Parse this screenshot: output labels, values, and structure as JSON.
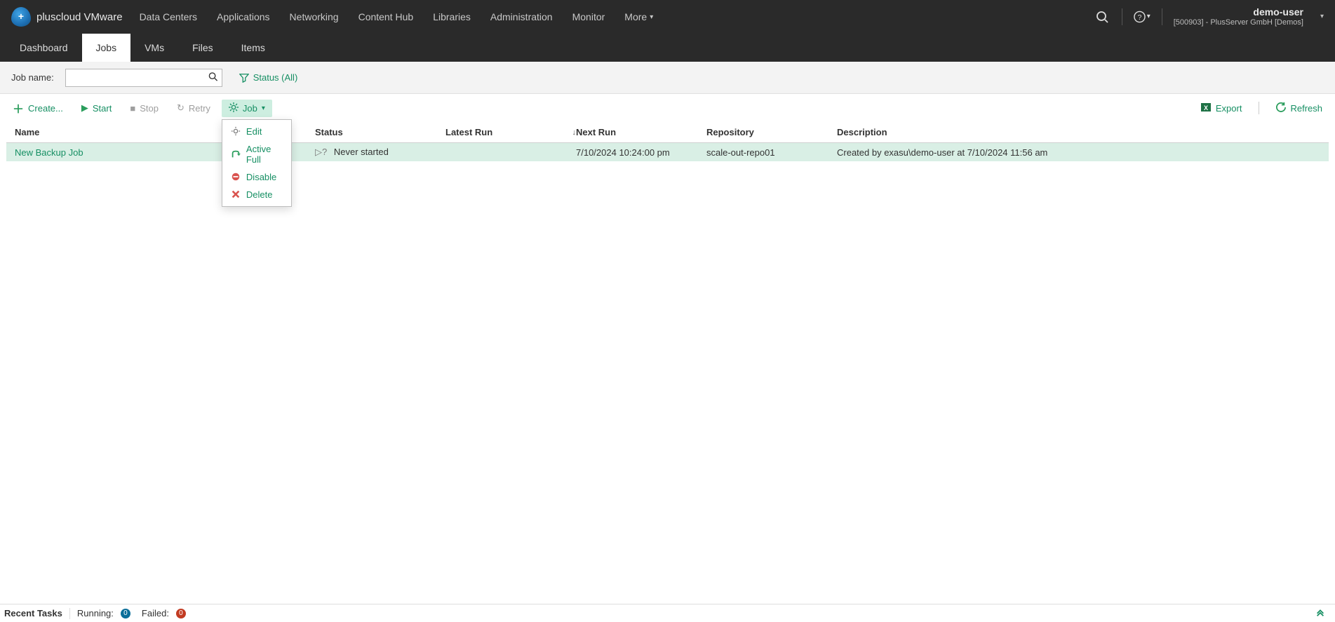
{
  "brand": {
    "text": "pluscloud VMware"
  },
  "topnav": {
    "items": [
      "Data Centers",
      "Applications",
      "Networking",
      "Content Hub",
      "Libraries",
      "Administration",
      "Monitor"
    ],
    "more": "More"
  },
  "user": {
    "name": "demo-user",
    "sub": "[500903] - PlusServer GmbH [Demos]"
  },
  "subtabs": [
    "Dashboard",
    "Jobs",
    "VMs",
    "Files",
    "Items"
  ],
  "subtab_active_index": 1,
  "filter": {
    "jobname_label": "Job name:",
    "jobname_value": "",
    "status_label": "Status (All)"
  },
  "toolbar": {
    "create": "Create...",
    "start": "Start",
    "stop": "Stop",
    "retry": "Retry",
    "job": "Job",
    "export": "Export",
    "refresh": "Refresh"
  },
  "job_menu": {
    "edit": "Edit",
    "active_full": "Active Full",
    "disable": "Disable",
    "delete": "Delete"
  },
  "table": {
    "headers": {
      "name": "Name",
      "status": "Status",
      "latest": "Latest Run",
      "next": "Next Run",
      "repo": "Repository",
      "desc": "Description"
    },
    "rows": [
      {
        "name": "New Backup Job",
        "status": "Never started",
        "latest": "",
        "next": "7/10/2024 10:24:00 pm",
        "repo": "scale-out-repo01",
        "desc": "Created by exasu\\demo-user at 7/10/2024 11:56 am"
      }
    ]
  },
  "bottom": {
    "recent": "Recent Tasks",
    "running_label": "Running:",
    "running_count": "0",
    "failed_label": "Failed:",
    "failed_count": "0"
  }
}
